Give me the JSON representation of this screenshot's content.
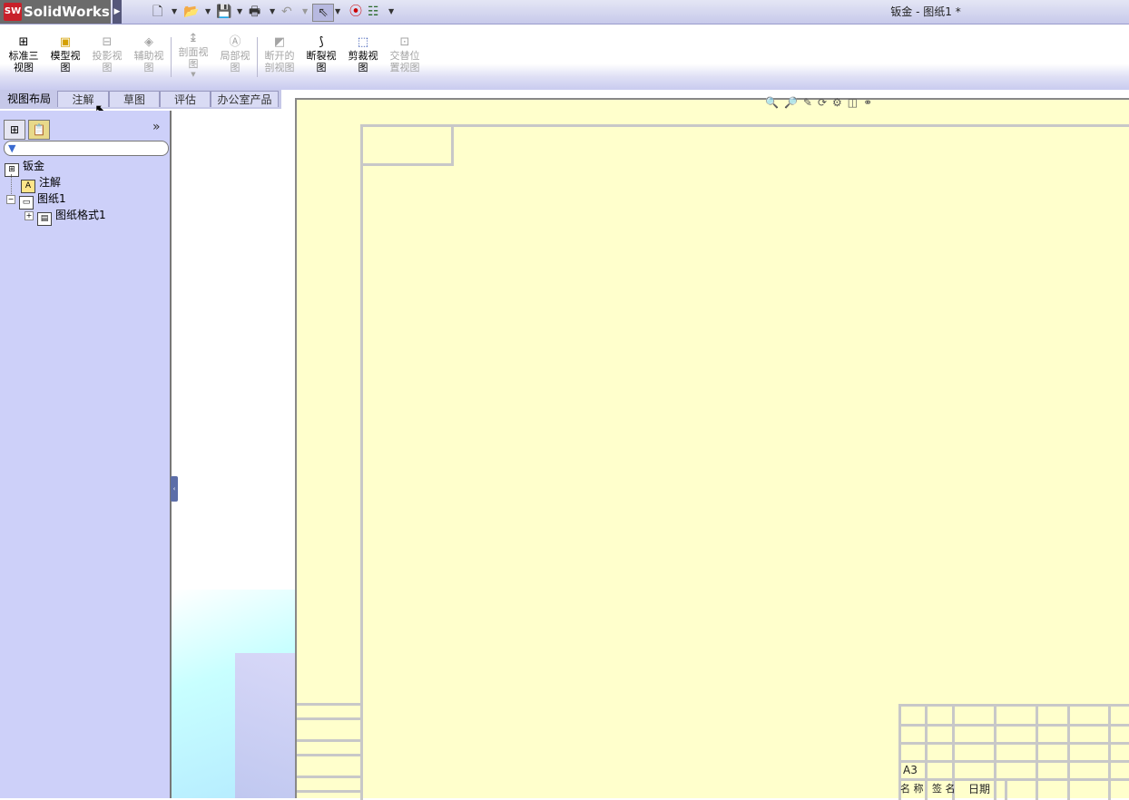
{
  "app": {
    "logo_text": "SolidWorks",
    "logo_badge": "SW",
    "document_title": "钣金 - 图纸1 *"
  },
  "quick_toolbar": {
    "icons": [
      "new-document-icon",
      "open-folder-icon",
      "save-icon",
      "print-icon",
      "undo-icon",
      "select-pointer-icon",
      "rebuild-traffic-light-icon",
      "options-icon"
    ]
  },
  "command_manager": {
    "buttons": [
      {
        "label_line1": "标准三",
        "label_line2": "视图",
        "enabled": true
      },
      {
        "label_line1": "模型视",
        "label_line2": "图",
        "enabled": true
      },
      {
        "label_line1": "投影视",
        "label_line2": "图",
        "enabled": false
      },
      {
        "label_line1": "辅助视",
        "label_line2": "图",
        "enabled": false
      },
      {
        "label_line1": "剖面视",
        "label_line2": "图",
        "enabled": false
      },
      {
        "label_line1": "局部视",
        "label_line2": "图",
        "enabled": false
      },
      {
        "label_line1": "断开的",
        "label_line2": "剖视图",
        "enabled": false
      },
      {
        "label_line1": "断裂视",
        "label_line2": "图",
        "enabled": true
      },
      {
        "label_line1": "剪裁视",
        "label_line2": "图",
        "enabled": true
      },
      {
        "label_line1": "交替位",
        "label_line2": "置视图",
        "enabled": false
      }
    ]
  },
  "tabs": [
    {
      "label": "视图布局",
      "active": true
    },
    {
      "label": "注解",
      "active": false
    },
    {
      "label": "草图",
      "active": false
    },
    {
      "label": "评估",
      "active": false
    },
    {
      "label": "办公室产品",
      "active": false
    }
  ],
  "feature_tree": {
    "root": "钣金",
    "items": [
      {
        "label": "注解",
        "icon": "annotation-icon"
      },
      {
        "label": "图纸1",
        "icon": "sheet-icon",
        "expanded": true
      },
      {
        "label": "图纸格式1",
        "icon": "sheet-format-icon",
        "expanded": false
      }
    ]
  },
  "title_block": {
    "size_label": "A3",
    "row_labels": [
      "名 称",
      "签 名",
      "日期"
    ]
  },
  "colors": {
    "sheet": "#ffffcc",
    "pane": "#cdd0f9",
    "sheet_border": "#c8c8c8"
  }
}
